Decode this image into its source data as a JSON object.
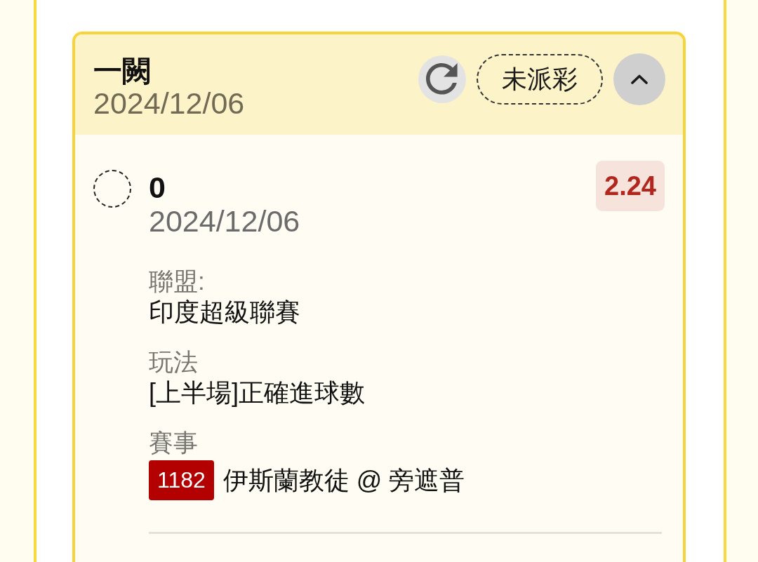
{
  "ticket": {
    "title": "一闕",
    "date": "2024/12/06",
    "status": "未派彩",
    "expanded": true,
    "selections": [
      {
        "name": "0",
        "date": "2024/12/06",
        "selected": false,
        "odds": "2.24",
        "fields": [
          {
            "kind": "text",
            "label": "聯盟:",
            "value": "印度超級聯賽"
          },
          {
            "kind": "text",
            "label": "玩法",
            "value": "[上半場]正確進球數"
          },
          {
            "kind": "match",
            "label": "賽事",
            "number": "1182",
            "value": "伊斯蘭教徒 @ 旁遮普"
          }
        ]
      }
    ]
  }
}
